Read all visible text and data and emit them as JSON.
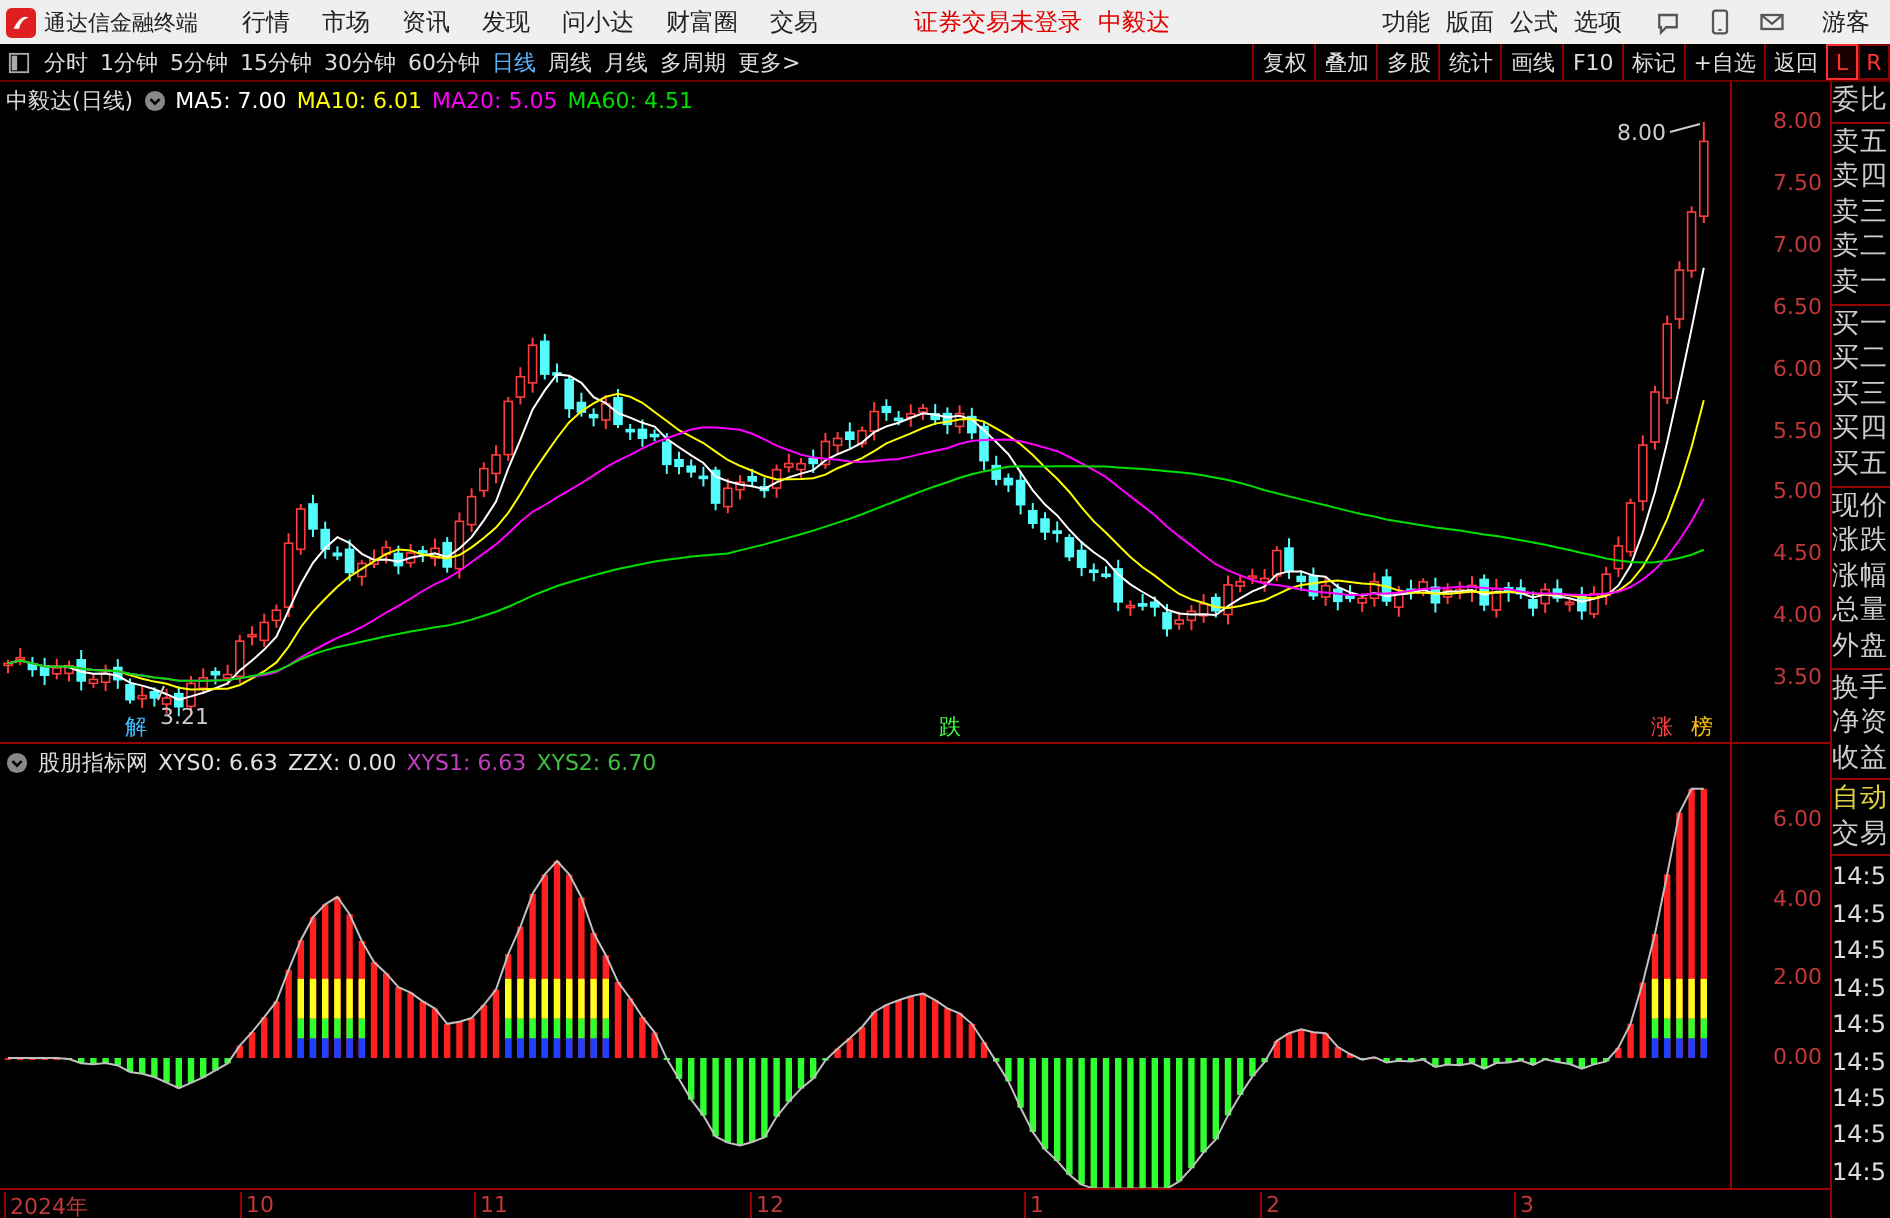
{
  "title_bar": {
    "app_name": "通达信金融终端",
    "menu": [
      "行情",
      "市场",
      "资讯",
      "发现",
      "问小达",
      "财富圈",
      "交易"
    ],
    "login_status": "证券交易未登录",
    "stock_name": "中毅达",
    "tools": [
      "功能",
      "版面",
      "公式",
      "选项"
    ],
    "user": "游客"
  },
  "toolbar": {
    "periods": [
      {
        "label": "分时",
        "selected": false
      },
      {
        "label": "1分钟",
        "selected": false
      },
      {
        "label": "5分钟",
        "selected": false
      },
      {
        "label": "15分钟",
        "selected": false
      },
      {
        "label": "30分钟",
        "selected": false
      },
      {
        "label": "60分钟",
        "selected": false
      },
      {
        "label": "日线",
        "selected": true
      },
      {
        "label": "周线",
        "selected": false
      },
      {
        "label": "月线",
        "selected": false
      },
      {
        "label": "多周期",
        "selected": false
      },
      {
        "label": "更多>",
        "selected": false
      }
    ],
    "actions": [
      "复权",
      "叠加",
      "多股",
      "统计",
      "画线",
      "F10",
      "标记",
      "+自选",
      "返回"
    ],
    "side_tabs": [
      {
        "label": "L",
        "selected": true
      },
      {
        "label": "R",
        "selected": false
      }
    ]
  },
  "price_chart": {
    "title": "中毅达(日线)",
    "ma": [
      {
        "label": "MA5: 7.00",
        "color": "#ffffff"
      },
      {
        "label": "MA10: 6.01",
        "color": "#ffff00"
      },
      {
        "label": "MA20: 5.05",
        "color": "#ff00ff"
      },
      {
        "label": "MA60: 4.51",
        "color": "#00e000"
      }
    ],
    "y_axis": [
      "8.00",
      "7.50",
      "7.00",
      "6.50",
      "6.00",
      "5.50",
      "5.00",
      "4.50",
      "4.00",
      "3.50"
    ],
    "high_label": "8.00",
    "low_label": "3.21",
    "markers": [
      {
        "label": "解",
        "color": "#40c0ff"
      },
      {
        "label": "跌",
        "color": "#40ff40"
      },
      {
        "label": "涨",
        "color": "#ff4040"
      },
      {
        "label": "榜",
        "color": "#ffc000"
      }
    ]
  },
  "indicator": {
    "name": "股朋指标网",
    "values": [
      {
        "label": "XYS0: 6.63",
        "color": "#e0e0e0"
      },
      {
        "label": "ZZX: 0.00",
        "color": "#e0e0e0"
      },
      {
        "label": "XYS1: 6.63",
        "color": "#c040c0"
      },
      {
        "label": "XYS2: 6.70",
        "color": "#40c040"
      }
    ],
    "y_axis": [
      "6.00",
      "4.00",
      "2.00",
      "0.00"
    ]
  },
  "x_axis": [
    "2024年",
    "10",
    "11",
    "12",
    "1",
    "2",
    "3"
  ],
  "right_panel": {
    "groups": [
      [
        "委比"
      ],
      [
        "卖五",
        "卖四",
        "卖三",
        "卖二",
        "卖一"
      ],
      [
        "买一",
        "买二",
        "买三",
        "买四",
        "买五"
      ],
      [
        "现价",
        "涨跌",
        "涨幅",
        "总量",
        "外盘"
      ],
      [
        "换手",
        "净资",
        "收益"
      ]
    ],
    "auto_label": "自动",
    "trade_label": "交易",
    "times": [
      "14:5",
      "14:5",
      "14:5",
      "14:5",
      "14:5",
      "14:5",
      "14:5",
      "14:5",
      "14:5"
    ]
  }
}
